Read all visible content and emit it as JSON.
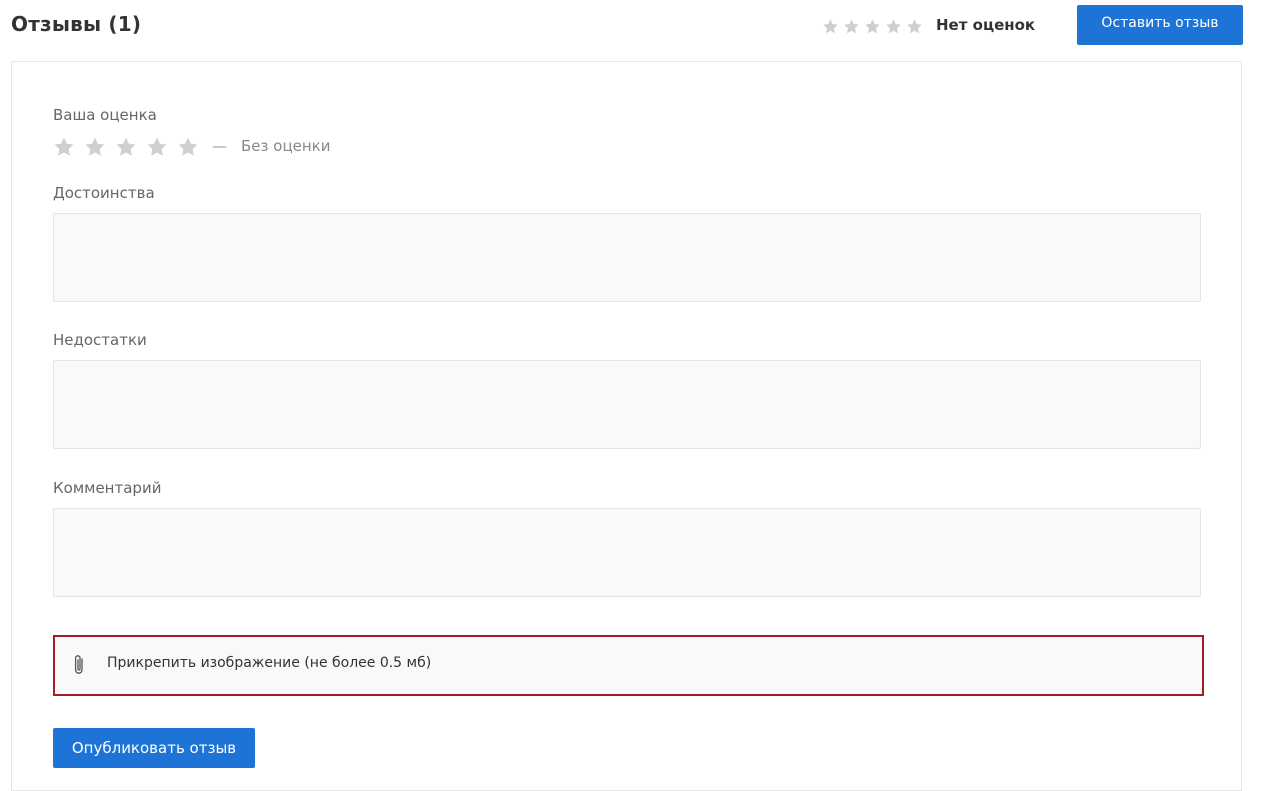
{
  "header": {
    "title": "Отзывы (1)",
    "summary_star_count": 5,
    "summary_text": "Нет оценок",
    "leave_review_label": "Оставить отзыв"
  },
  "form": {
    "rating": {
      "label": "Ваша оценка",
      "star_count": 5,
      "dash": "—",
      "value_text": "Без оценки"
    },
    "pros": {
      "label": "Достоинства",
      "value": ""
    },
    "cons": {
      "label": "Недостатки",
      "value": ""
    },
    "comment": {
      "label": "Комментарий",
      "value": ""
    },
    "attach": {
      "label": "Прикрепить изображение (не более 0.5 мб)"
    },
    "publish_label": "Опубликовать отзыв"
  },
  "icons": {
    "star": "star-icon",
    "attach": "paperclip-icon"
  },
  "colors": {
    "accent": "#1e74d6",
    "star_empty": "#cfcfcf",
    "attach_border": "#a51d24"
  }
}
